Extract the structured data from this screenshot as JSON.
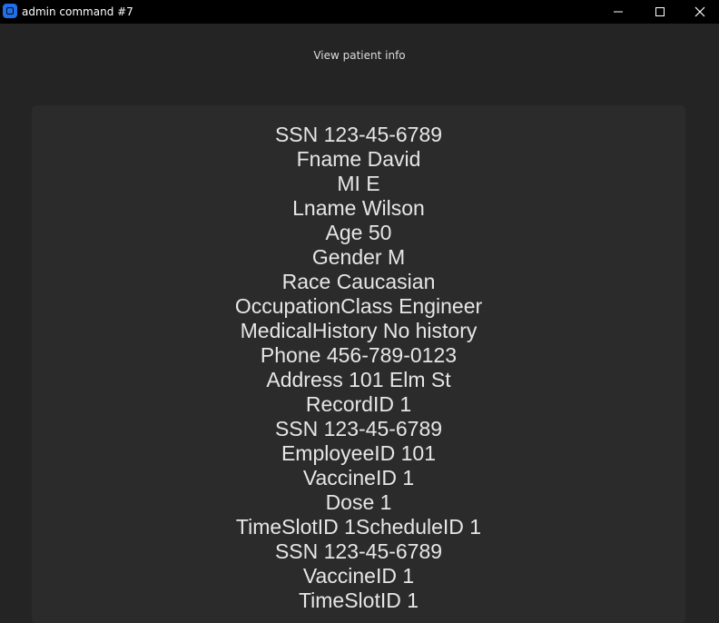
{
  "window": {
    "title": "admin command #7",
    "icons": {
      "app": "app-icon",
      "minimize": "minimize-icon",
      "maximize": "maximize-icon",
      "close": "close-icon"
    }
  },
  "page": {
    "heading": "View patient info"
  },
  "record_lines": [
    "SSN 123-45-6789",
    "Fname David",
    "MI E",
    "Lname Wilson",
    "Age 50",
    "Gender M",
    "Race Caucasian",
    "OccupationClass Engineer",
    "MedicalHistory No history",
    "Phone 456-789-0123",
    "Address 101 Elm St",
    "RecordID 1",
    "SSN 123-45-6789",
    "EmployeeID 101",
    "VaccineID 1",
    "Dose 1",
    "TimeSlotID 1ScheduleID 1",
    "SSN 123-45-6789",
    "VaccineID 1",
    "TimeSlotID 1"
  ],
  "colors": {
    "titlebar": "#000000",
    "background": "#242424",
    "panel": "#2b2b2b",
    "text": "#e6e6e6",
    "accent": "#1f6feb"
  }
}
